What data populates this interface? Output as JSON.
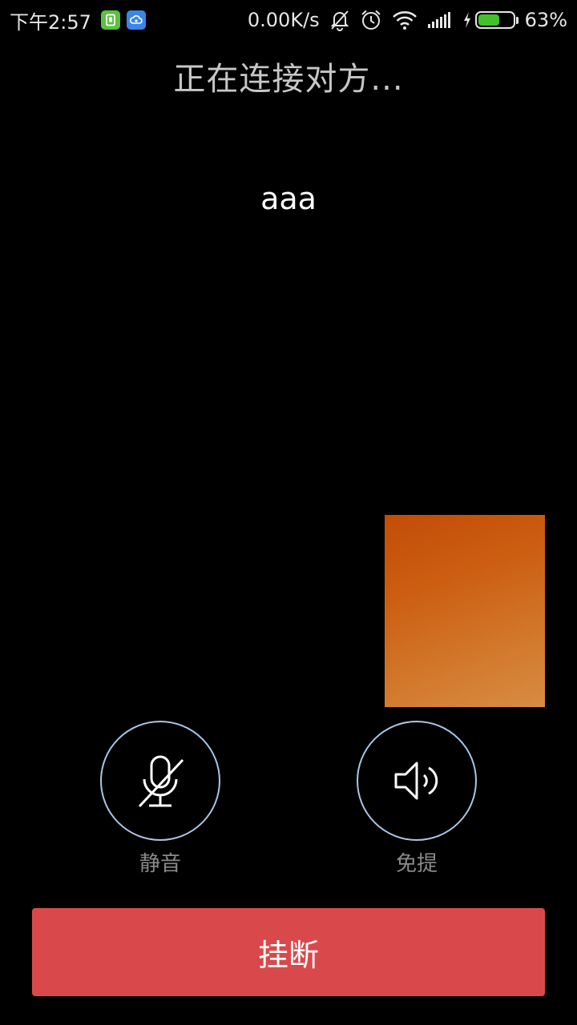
{
  "status_bar": {
    "time": "下午2:57",
    "network_speed": "0.00K/s",
    "battery_percent_label": "63%",
    "battery_level": 0.63,
    "icons": [
      "sim-app-icon",
      "cloud-app-icon",
      "bell-off-icon",
      "alarm-clock-icon",
      "wifi-icon",
      "signal-icon",
      "charging-icon",
      "battery-icon"
    ]
  },
  "call": {
    "status_text": "正在连接对方...",
    "callee_name": "aaa"
  },
  "controls": {
    "mute_label": "静音",
    "speaker_label": "免提",
    "hangup_label": "挂断"
  },
  "colors": {
    "background": "#000000",
    "hangup": "#d9494b",
    "ring": "#a9c6e6",
    "battery": "#42c12b"
  }
}
